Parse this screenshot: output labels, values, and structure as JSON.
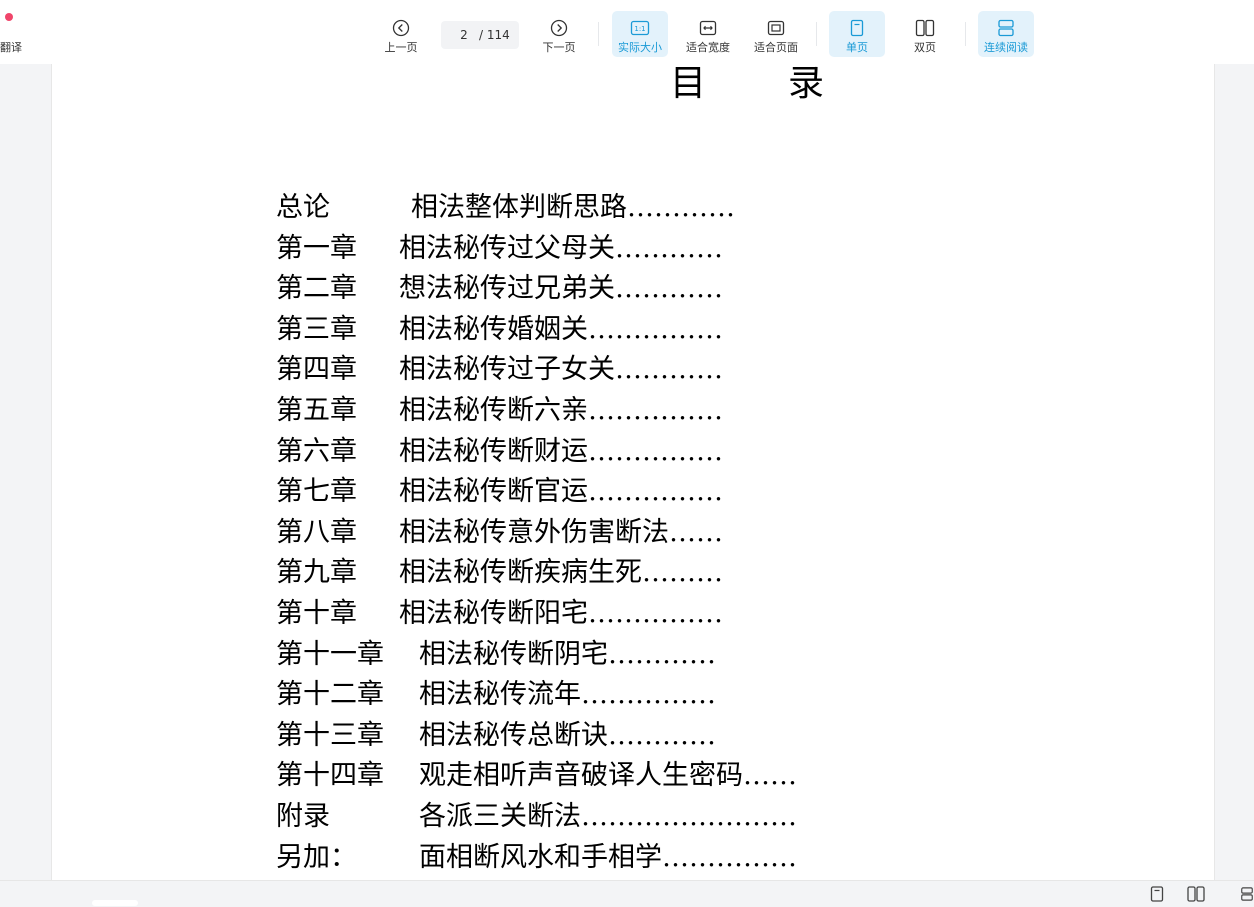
{
  "toolbar": {
    "left_label": "翻译",
    "prev_label": "上一页",
    "current_page": "2",
    "total_pages": "/ 114",
    "next_label": "下一页",
    "actual_size_label": "实际大小",
    "actual_size_glyph": "1:1",
    "fit_width_label": "适合宽度",
    "fit_page_label": "适合页面",
    "single_page_label": "单页",
    "double_page_label": "双页",
    "continuous_label": "连续阅读"
  },
  "document": {
    "title": "目录",
    "toc": [
      {
        "chapter": "总论",
        "title": "相法整体判断思路",
        "dots": "…………",
        "indent": 135
      },
      {
        "chapter": "第一章",
        "title": "相法秘传过父母关",
        "dots": "…………",
        "indent": 123
      },
      {
        "chapter": "第二章",
        "title": "想法秘传过兄弟关",
        "dots": "…………",
        "indent": 123
      },
      {
        "chapter": "第三章",
        "title": "相法秘传婚姻关",
        "dots": "……………",
        "indent": 123
      },
      {
        "chapter": "第四章",
        "title": "相法秘传过子女关",
        "dots": "…………",
        "indent": 123
      },
      {
        "chapter": "第五章",
        "title": "相法秘传断六亲",
        "dots": "……………",
        "indent": 123
      },
      {
        "chapter": "第六章",
        "title": "相法秘传断财运",
        "dots": "……………",
        "indent": 123
      },
      {
        "chapter": "第七章",
        "title": "相法秘传断官运",
        "dots": "……………",
        "indent": 123
      },
      {
        "chapter": "第八章",
        "title": "相法秘传意外伤害断法",
        "dots": "……",
        "indent": 123
      },
      {
        "chapter": "第九章",
        "title": "相法秘传断疾病生死",
        "dots": "………",
        "indent": 123
      },
      {
        "chapter": "第十章",
        "title": "相法秘传断阳宅",
        "dots": "……………",
        "indent": 123
      },
      {
        "chapter": "第十一章",
        "title": "相法秘传断阴宅",
        "dots": "…………",
        "indent": 143
      },
      {
        "chapter": "第十二章",
        "title": "相法秘传流年",
        "dots": "……………",
        "indent": 143
      },
      {
        "chapter": "第十三章",
        "title": "相法秘传总断诀",
        "dots": "…………",
        "indent": 143
      },
      {
        "chapter": "第十四章",
        "title": "观走相听声音破译人生密码",
        "dots": "……",
        "indent": 143
      },
      {
        "chapter": "附录",
        "title": "各派三关断法",
        "dots": "……………………",
        "indent": 143
      },
      {
        "chapter": "另加：",
        "title": "面相断风水和手相学",
        "dots": "……………",
        "indent": 143
      }
    ]
  },
  "colors": {
    "accent": "#1a9ad6",
    "active_bg": "#e3f2fb",
    "notification_dot": "#f0456a"
  }
}
